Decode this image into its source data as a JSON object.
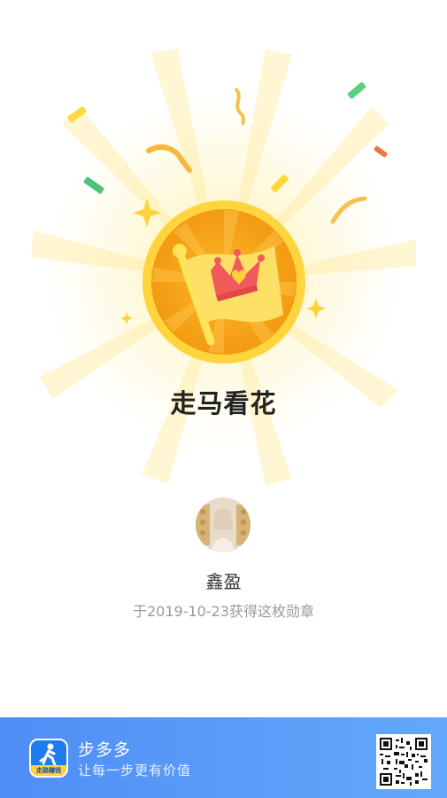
{
  "badge": {
    "title": "走马看花",
    "icon": "flag-crown-medal"
  },
  "user": {
    "name": "鑫盈",
    "avatar": "user-avatar"
  },
  "award": {
    "date_text": "于2019-10-23获得这枚勋章"
  },
  "footer": {
    "app_name": "步多多",
    "slogan": "让每一步更有价值",
    "app_icon_label": "走路赚钱",
    "qr": "qr-code"
  },
  "colors": {
    "medal_gold": "#f9b21d",
    "medal_inner": "#f6a01a",
    "flag": "#ffe066",
    "crown": "#f05a5a",
    "footer_blue": "#4f8ef5"
  }
}
